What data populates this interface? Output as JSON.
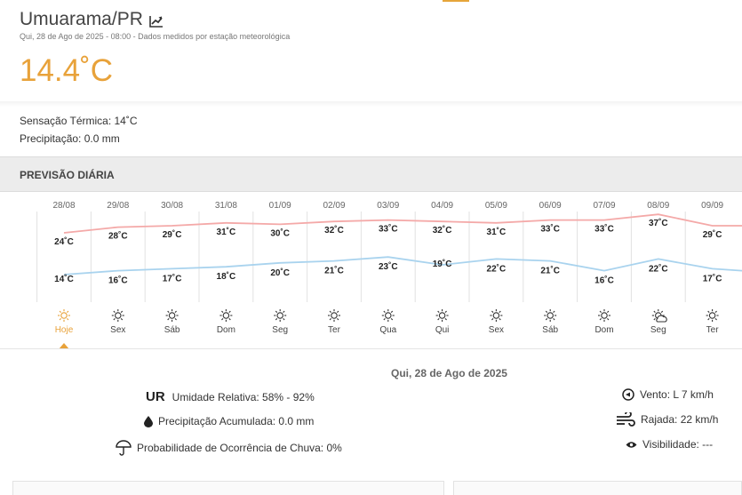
{
  "header": {
    "city": "Umuarama/PR",
    "subtitle": "Qui, 28 de Ago de 2025 - 08:00 - Dados medidos por estação meteorológica",
    "temperature": "14.4˚C",
    "trend_icon": "chart-line-icon"
  },
  "current": {
    "feels_like": "Sensação Térmica: 14˚C",
    "precipitation": "Precipitação: 0.0 mm"
  },
  "forecast": {
    "title": "PREVISÃO DIÁRIA",
    "days": [
      {
        "date": "28/08",
        "max": "24˚C",
        "min": "14˚C",
        "day": "Hoje",
        "icon": "sun-icon"
      },
      {
        "date": "29/08",
        "max": "28˚C",
        "min": "16˚C",
        "day": "Sex",
        "icon": "sun-icon"
      },
      {
        "date": "30/08",
        "max": "29˚C",
        "min": "17˚C",
        "day": "Sáb",
        "icon": "sun-icon"
      },
      {
        "date": "31/08",
        "max": "31˚C",
        "min": "18˚C",
        "day": "Dom",
        "icon": "sun-icon"
      },
      {
        "date": "01/09",
        "max": "30˚C",
        "min": "20˚C",
        "day": "Seg",
        "icon": "sun-icon"
      },
      {
        "date": "02/09",
        "max": "32˚C",
        "min": "21˚C",
        "day": "Ter",
        "icon": "sun-icon"
      },
      {
        "date": "03/09",
        "max": "33˚C",
        "min": "23˚C",
        "day": "Qua",
        "icon": "sun-icon"
      },
      {
        "date": "04/09",
        "max": "32˚C",
        "min": "19˚C",
        "day": "Qui",
        "icon": "sun-icon"
      },
      {
        "date": "05/09",
        "max": "31˚C",
        "min": "22˚C",
        "day": "Sex",
        "icon": "sun-icon"
      },
      {
        "date": "06/09",
        "max": "33˚C",
        "min": "21˚C",
        "day": "Sáb",
        "icon": "sun-icon"
      },
      {
        "date": "07/09",
        "max": "33˚C",
        "min": "16˚C",
        "day": "Dom",
        "icon": "sun-icon"
      },
      {
        "date": "08/09",
        "max": "37˚C",
        "min": "22˚C",
        "day": "Seg",
        "icon": "sun-cloud-icon"
      },
      {
        "date": "09/09",
        "max": "29˚C",
        "min": "17˚C",
        "day": "Ter",
        "icon": "sun-icon"
      }
    ],
    "max_values": [
      24,
      28,
      29,
      31,
      30,
      32,
      33,
      32,
      31,
      33,
      33,
      37,
      29
    ],
    "min_values": [
      14,
      16,
      17,
      18,
      20,
      21,
      23,
      19,
      22,
      21,
      16,
      22,
      17
    ],
    "colors": {
      "max_line": "#f4a9a8",
      "min_line": "#a9d3ee",
      "selected": "#e8a23a"
    }
  },
  "details": {
    "date": "Qui, 28 de Ago de 2025",
    "ur_label": "UR",
    "humidity": "Umidade Relativa: 58% - 92%",
    "precip_acc": "Precipitação Acumulada: 0.0 mm",
    "rain_prob": "Probabilidade de Ocorrência de Chuva: 0%",
    "wind": "Vento: L 7 km/h",
    "gust": "Rajada: 22 km/h",
    "visibility": "Visibilidade: ---"
  }
}
